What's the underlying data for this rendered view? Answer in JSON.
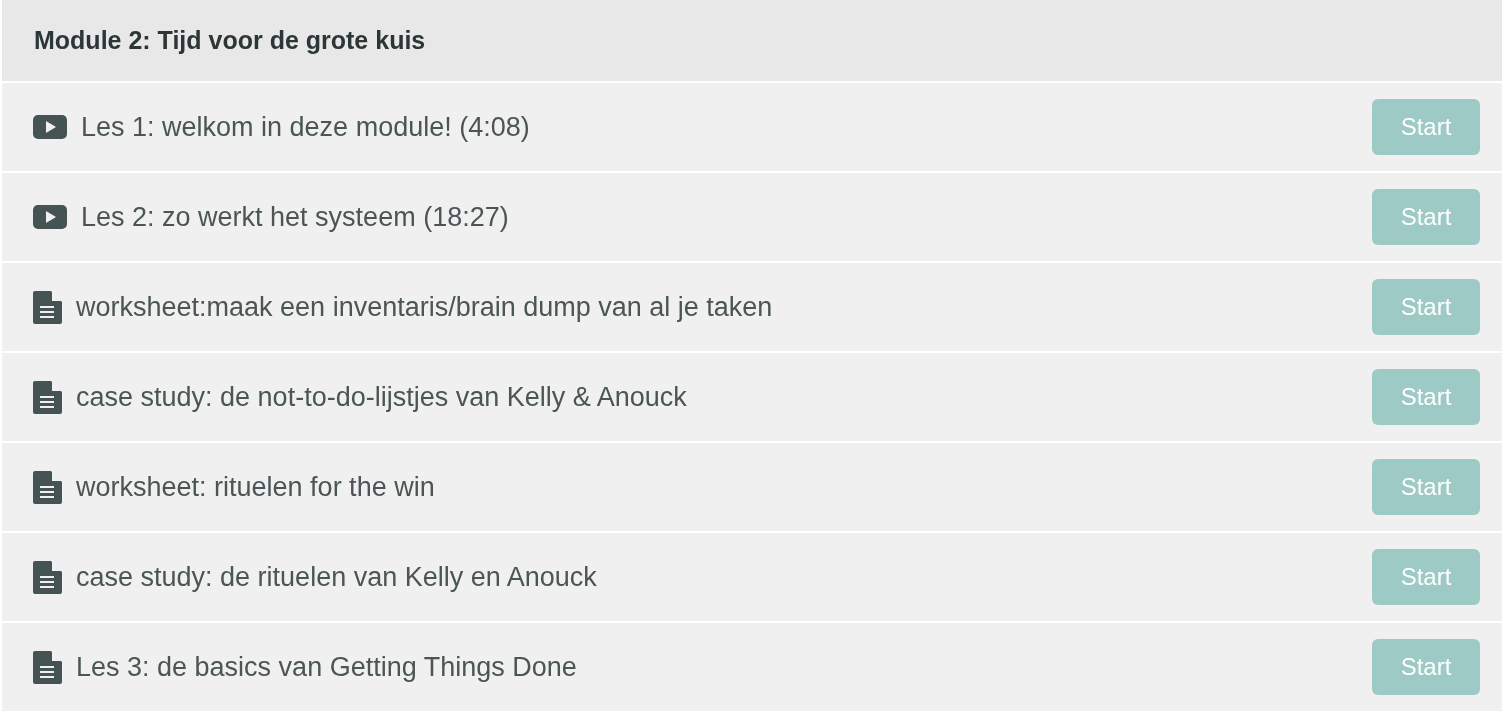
{
  "module": {
    "title": "Module 2: Tijd voor de grote kuis"
  },
  "lessons": [
    {
      "kind": "video",
      "title": "Les 1: welkom in deze module! (4:08)",
      "button": "Start"
    },
    {
      "kind": "video",
      "title": "Les 2: zo werkt het systeem (18:27)",
      "button": "Start"
    },
    {
      "kind": "document",
      "title": "worksheet:maak een inventaris/brain dump van al je taken",
      "button": "Start"
    },
    {
      "kind": "document",
      "title": "case study: de not-to-do-lijstjes van Kelly & Anouck",
      "button": "Start"
    },
    {
      "kind": "document",
      "title": "worksheet: rituelen for the win",
      "button": "Start"
    },
    {
      "kind": "document",
      "title": "case study: de rituelen van Kelly en Anouck",
      "button": "Start"
    },
    {
      "kind": "document",
      "title": "Les 3: de basics van Getting Things Done",
      "button": "Start"
    }
  ]
}
